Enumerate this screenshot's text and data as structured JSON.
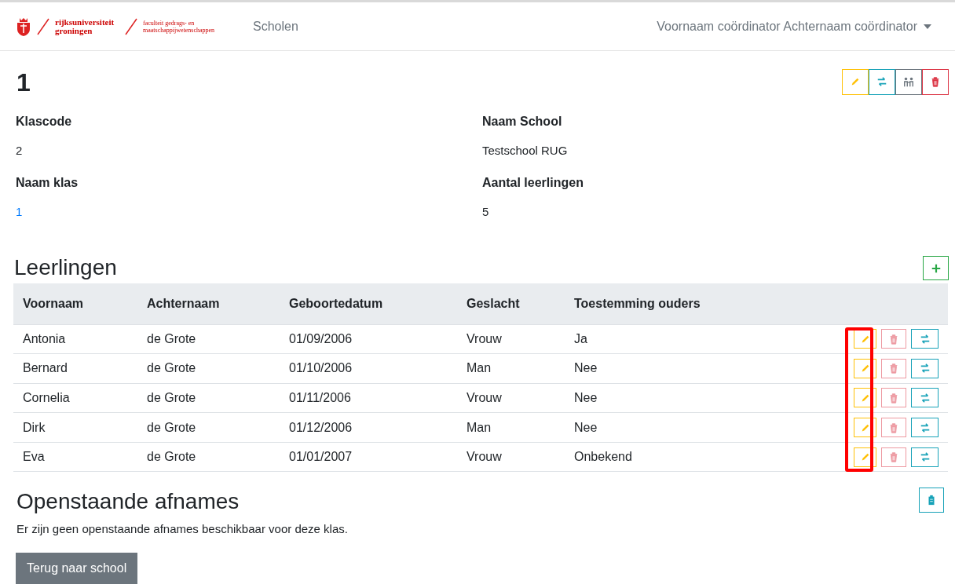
{
  "header": {
    "logo": {
      "university": "rijksuniversiteit groningen",
      "faculty": "faculteit gedrags- en maatschappijwetenschappen"
    },
    "nav": [
      {
        "label": "Scholen"
      }
    ],
    "user_menu": "Voornaam coördinator Achternaam coördinator"
  },
  "class": {
    "title": "1",
    "actions": [
      {
        "kind": "edit"
      },
      {
        "kind": "transfer"
      },
      {
        "kind": "group"
      },
      {
        "kind": "delete"
      }
    ],
    "fields": [
      {
        "label": "Klascode",
        "value": "2",
        "link": false
      },
      {
        "label": "Naam School",
        "value": "Testschool RUG",
        "link": false
      },
      {
        "label": "Naam klas",
        "value": "1",
        "link": true
      },
      {
        "label": "Aantal leerlingen",
        "value": "5",
        "link": false
      }
    ]
  },
  "students": {
    "title": "Leerlingen",
    "columns": [
      "Voornaam",
      "Achternaam",
      "Geboortedatum",
      "Geslacht",
      "Toestemming ouders"
    ],
    "rows": [
      {
        "cells": [
          "Antonia",
          "de Grote",
          "01/09/2006",
          "Vrouw",
          "Ja"
        ],
        "delete_disabled": true
      },
      {
        "cells": [
          "Bernard",
          "de Grote",
          "01/10/2006",
          "Man",
          "Nee"
        ],
        "delete_disabled": true
      },
      {
        "cells": [
          "Cornelia",
          "de Grote",
          "01/11/2006",
          "Vrouw",
          "Nee"
        ],
        "delete_disabled": true
      },
      {
        "cells": [
          "Dirk",
          "de Grote",
          "01/12/2006",
          "Man",
          "Nee"
        ],
        "delete_disabled": true
      },
      {
        "cells": [
          "Eva",
          "de Grote",
          "01/01/2007",
          "Vrouw",
          "Onbekend"
        ],
        "delete_disabled": true
      }
    ],
    "highlight_edit_column": true
  },
  "pending": {
    "title": "Openstaande afnames",
    "message": "Er zijn geen openstaande afnames beschikbaar voor deze klas."
  },
  "back_button": "Terug naar school"
}
